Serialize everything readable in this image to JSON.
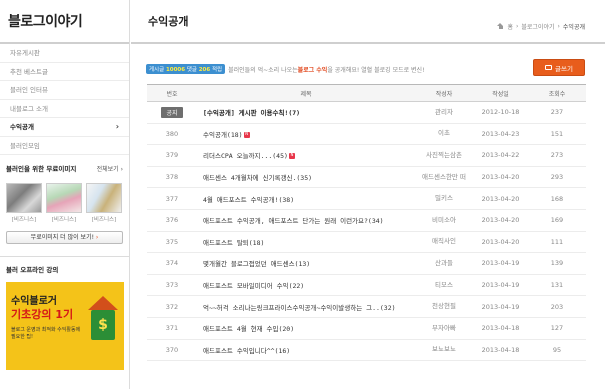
{
  "sidebar": {
    "brand": "블로그이야기",
    "menu": [
      {
        "label": "자유게시판",
        "active": false
      },
      {
        "label": "추천 베스트글",
        "active": false
      },
      {
        "label": "블러인 인터뷰",
        "active": false
      },
      {
        "label": "내블로그 소개",
        "active": false
      },
      {
        "label": "수익공개",
        "active": true
      },
      {
        "label": "블러인모임",
        "active": false
      }
    ],
    "active_chevron": "›",
    "free_images": {
      "title": "블러인을 위한 무료이미지",
      "more": "전체보기 ›",
      "captions": [
        "[비즈니스]",
        "[비즈니스]",
        "[비즈니스]"
      ],
      "button_label": "무료이미지 더 많이 보기!",
      "button_arrow": "›"
    },
    "offline": {
      "title": "블러 오프라인 강의",
      "banner_line1": "수익블로거",
      "banner_line2": "기초강의 1기",
      "banner_line3": "블로그 운영과 최적화 수익활동에 필요한 팁!",
      "banner_symbol": "$"
    }
  },
  "main": {
    "title": "수익공개",
    "breadcrumb": [
      "홈",
      "블로그이야기",
      "수익공개"
    ],
    "notice_tag_prefix": "게시글",
    "notice_posts": "10006",
    "notice_mid": "댓글",
    "notice_comments": "206",
    "notice_suffix": "적립",
    "notice_text1": "블러인들의 억~소리 나오는 ",
    "notice_red": "블로그 수익",
    "notice_text2": "을 공개해요! 열혈 블로깅 모드로 변신!",
    "write_button": "글쓰기",
    "columns": [
      "번호",
      "제목",
      "작성자",
      "작성일",
      "조회수"
    ],
    "rows": [
      {
        "no": "공지",
        "title": "[수익공개] 게시판 이용수칙!(7)",
        "new": false,
        "author": "관리자",
        "date": "2012-10-18",
        "views": "237",
        "notice": true
      },
      {
        "no": "380",
        "title": "수익공개(18)",
        "new": true,
        "author": "이초",
        "date": "2013-04-23",
        "views": "151",
        "notice": false
      },
      {
        "no": "379",
        "title": "리더스CPA 오늘까지...(45)",
        "new": true,
        "author": "사진찍는삼촌",
        "date": "2013-04-22",
        "views": "273",
        "notice": false
      },
      {
        "no": "378",
        "title": "애드센스 4개월차에 신기록갱신.(35)",
        "new": false,
        "author": "애드센스한만 떠",
        "date": "2013-04-20",
        "views": "293",
        "notice": false
      },
      {
        "no": "377",
        "title": "4월 애드포스트 수익공개!(38)",
        "new": false,
        "author": "밀키스",
        "date": "2013-04-20",
        "views": "168",
        "notice": false
      },
      {
        "no": "376",
        "title": "애드포스트 수익공개, 애드포스트 단가는 원래 이런가요?(34)",
        "new": false,
        "author": "비미소아",
        "date": "2013-04-20",
        "views": "169",
        "notice": false
      },
      {
        "no": "375",
        "title": "애드포스트 탈퇴(18)",
        "new": false,
        "author": "매직사인",
        "date": "2013-04-20",
        "views": "111",
        "notice": false
      },
      {
        "no": "374",
        "title": "몇개월간 블로그접었던 애드센스(13)",
        "new": false,
        "author": "산과들",
        "date": "2013-04-19",
        "views": "139",
        "notice": false
      },
      {
        "no": "373",
        "title": "애드포스트 모바일미디어 수익(22)",
        "new": false,
        "author": "티모스",
        "date": "2013-04-19",
        "views": "131",
        "notice": false
      },
      {
        "no": "372",
        "title": "억~~허걱 소리나는링크프라이스수익공개~수익이발생하는 그..(32)",
        "new": false,
        "author": "천상현필",
        "date": "2013-04-19",
        "views": "203",
        "notice": false
      },
      {
        "no": "371",
        "title": "애드포스트 4월 현재 수입(20)",
        "new": false,
        "author": "부자아빠",
        "date": "2013-04-18",
        "views": "127",
        "notice": false
      },
      {
        "no": "370",
        "title": "애드포스트 수익입니다^^(16)",
        "new": false,
        "author": "보뇨보뇨",
        "date": "2013-04-18",
        "views": "95",
        "notice": false
      }
    ]
  }
}
